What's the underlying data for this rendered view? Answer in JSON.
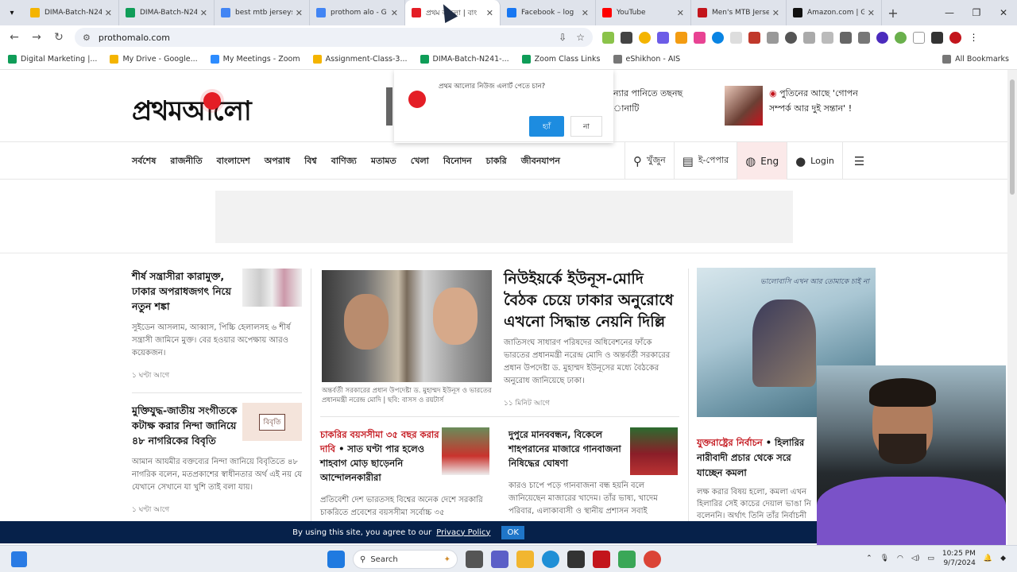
{
  "browser": {
    "tabs": [
      {
        "title": "DIMA-Batch-N24",
        "color": "#f4b400"
      },
      {
        "title": "DIMA-Batch-N24",
        "color": "#0f9d58"
      },
      {
        "title": "best mtb jerseys",
        "color": "#4285f4"
      },
      {
        "title": "prothom alo - G",
        "color": "#4285f4"
      },
      {
        "title": "প্রথম আলো | বাং",
        "color": "#e41e26"
      },
      {
        "title": "Facebook – log",
        "color": "#1877f2"
      },
      {
        "title": "YouTube",
        "color": "#ff0000"
      },
      {
        "title": "Men's MTB Jerse",
        "color": "#c3151c"
      },
      {
        "title": "Amazon.com | G",
        "color": "#111111"
      }
    ],
    "new_tab": "+",
    "url": "prothomalo.com",
    "bookmarks": [
      {
        "label": "Digital Marketing |...",
        "color": "#0f9d58"
      },
      {
        "label": "My Drive - Google...",
        "color": "#f4b400"
      },
      {
        "label": "My Meetings - Zoom",
        "color": "#2d8cff"
      },
      {
        "label": "Assignment-Class-3...",
        "color": "#f4b400"
      },
      {
        "label": "DIMA-Batch-N241-...",
        "color": "#0f9d58"
      },
      {
        "label": "Zoom Class Links",
        "color": "#0f9d58"
      },
      {
        "label": "eShikhon - AIS",
        "color": "#777777"
      }
    ],
    "all_bookmarks": "All Bookmarks"
  },
  "site": {
    "logo": "প্রথমআলো",
    "notification": {
      "question": "প্রথম আলোর নিউজ এলার্ট পেতে চান?",
      "yes": "হ্যাঁ",
      "no": "না"
    },
    "top_headline_1a": "ন্যার পানিতে তছনছ",
    "top_headline_1b": "ানাটি",
    "top_headline_2a": "পুতিনের আছে 'গোপন",
    "top_headline_2b": "সম্পর্ক আর দুই সন্তান' !",
    "menu": [
      "সর্বশেষ",
      "রাজনীতি",
      "বাংলাদেশ",
      "অপরাধ",
      "বিশ্ব",
      "বাণিজ্য",
      "মতামত",
      "খেলা",
      "বিনোদন",
      "চাকরি",
      "জীবনযাপন"
    ],
    "tools": {
      "search": "খুঁজুন",
      "epaper": "ই-পেপার",
      "lang": "Eng",
      "login": "Login"
    },
    "col1": [
      {
        "title": "শীর্ষ সন্ত্রাসীরা কারামুক্ত, ঢাকার অপরাধজগৎ নিয়ে নতুন শঙ্কা",
        "body": "সুইডেন আসলাম, আব্বাস, পিচ্চি হেলালসহ ৬ শীর্ষ সন্ত্রাসী জামিনে মুক্ত। বের হওয়ার অপেক্ষায় আরও কয়েকজন।",
        "time": "১ ঘণ্টা আগে"
      },
      {
        "title": "মুক্তিযুদ্ধ-জাতীয় সংগীতকে কটাক্ষ করার নিন্দা জানিয়ে ৪৮ নাগরিকের বিবৃতি",
        "body": "আমান আযমীর বক্তব্যের নিন্দা জানিয়ে বিবৃতিতে ৪৮ নাগরিক বলেন, মতপ্রকাশের স্বাধীনতার অর্থ এই নয় যে যেখানে সেখানে যা খুশি তাই বলা যায়।",
        "time": "১ ঘণ্টা আগে",
        "thumb_label": "বিবৃতি"
      }
    ],
    "lead": {
      "title": "নিউইয়র্কে ইউনূস-মোদি বৈঠক চেয়ে ঢাকার অনুরোধে এখনো সিদ্ধান্ত নেয়নি দিল্লি",
      "caption": "অন্তর্বর্তী সরকারের প্রধান উপদেষ্টা ড. মুহাম্মদ ইউনূস ও ভারতের প্রধানমন্ত্রী নরেন্দ্র মোদি | ছবি: বাসস ও রয়টার্স",
      "body": "জাতিসংঘ সাধারণ পরিষদের অধিবেশনের ফাঁকে ভারতের প্রধানমন্ত্রী নরেন্দ্র মোদি ও অন্তর্বর্তী সরকারের প্রধান উপদেষ্টা ড. মুহাম্মদ ইউনূসের মধ্যে বৈঠকের অনুরোধ জানিয়েছে ঢাকা।",
      "time": "১১ মিনিট আগে"
    },
    "sub1": {
      "kicker": "চাকরির বয়সসীমা ৩৫ বছর করার দাবি",
      "title": " • সাত ঘণ্টা পার হলেও শাহবাগ মোড় ছাড়েননি আন্দোলনকারীরা",
      "body": "প্রতিবেশী দেশ ভারতসহ বিশ্বের অনেক দেশে সরকারি চাকরিতে প্রবেশের বয়সসীমা সর্বোচ্চ ৩৫"
    },
    "sub2": {
      "title": "দুপুরে মানববন্ধন, বিকেলে শাহপরানের মাজারে গানবাজনা নিষিদ্ধের ঘোষণা",
      "body": "কারও চাপে পড়ে গানবাজনা বন্ধ হয়নি বলে জানিয়েছেন মাজারের খাদেম। তাঁর ভাষ্য, খাদেম পরিবার, এলাকাবাসী ও স্থানীয় প্রশাসন সবাই"
    },
    "side": {
      "img_text": "ভালোবাসি এখন আর তোমাকে চাই না",
      "kicker": "যুক্তরাষ্ট্রের নির্বাচন",
      "title": " • হিলারির নারীবাদী প্রচার থেকে সরে যাচ্ছেন কমলা",
      "body": "লক্ষ করার বিষয় হলো, কমলা এখন হিলারির সেই কাচের দেয়াল ভাঙা নি বলেননি। অর্থাৎ তিনি তাঁর নির্বাচনী"
    },
    "cookie": {
      "text": "By using this site, you agree to our",
      "link": "Privacy Policy",
      "ok": "OK"
    }
  },
  "taskbar": {
    "search": "Search",
    "time": "10:25 PM",
    "date": "9/7/2024"
  }
}
